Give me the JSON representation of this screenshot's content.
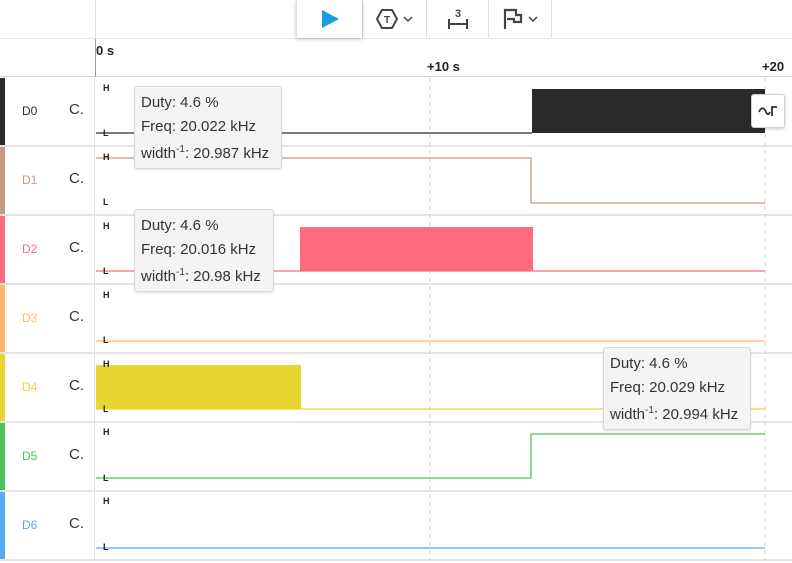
{
  "toolbar": {
    "play_icon": "play-icon",
    "trigger_icon": "trigger-icon",
    "trigger_label": "T",
    "samples_icon": "samples-icon",
    "samples_label": "3",
    "annotation_icon": "annotation-icon",
    "edge_icon": "edge-icon"
  },
  "ruler": {
    "ticks": [
      "0 s",
      "+10 s",
      "+20"
    ]
  },
  "colors": {
    "D0": "#2b2b2b",
    "D1": "#c79a80",
    "D2": "#ff6b7e",
    "D3": "#ffb866",
    "D4": "#e8d630",
    "D5": "#4cc35a",
    "D6": "#55aaf2",
    "play": "#1e9be0"
  },
  "level": {
    "high": "H",
    "low": "L"
  },
  "channels": [
    {
      "name": "D0",
      "c": "C."
    },
    {
      "name": "D1",
      "c": "C."
    },
    {
      "name": "D2",
      "c": "C."
    },
    {
      "name": "D3",
      "c": "C."
    },
    {
      "name": "D4",
      "c": "C."
    },
    {
      "name": "D5",
      "c": "C."
    },
    {
      "name": "D6",
      "c": "C."
    }
  ],
  "measurements": [
    {
      "duty": "Duty: 4.6 %",
      "freq": "Freq: 20.022 kHz",
      "width_prefix": "width",
      "width_exp": "-1",
      "width_value": ": 20.987 kHz"
    },
    {
      "duty": "Duty: 4.6 %",
      "freq": "Freq: 20.016 kHz",
      "width_prefix": "width",
      "width_exp": "-1",
      "width_value": ": 20.98 kHz"
    },
    {
      "duty": "Duty: 4.6 %",
      "freq": "Freq: 20.029 kHz",
      "width_prefix": "width",
      "width_exp": "-1",
      "width_value": ": 20.994 kHz"
    }
  ]
}
